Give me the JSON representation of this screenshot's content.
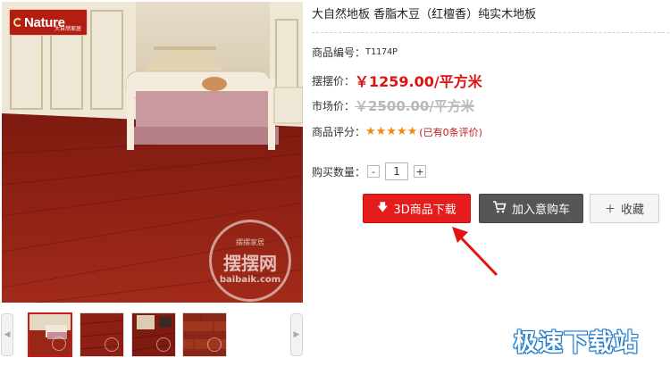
{
  "brand": {
    "logo_text": "Nature",
    "logo_sub": "大自然家居"
  },
  "main_image": {
    "watermark_top": "摆摆家居",
    "watermark_mid": "摆摆网",
    "watermark_bottom": "baibaik.com"
  },
  "product": {
    "title": "大自然地板 香脂木豆（红檀香）纯实木地板",
    "sku_label": "商品编号：",
    "sku_value": "T1174P",
    "price_label": "摆摆价：",
    "price_value": "￥1259.00/平方米",
    "market_label": "市场价：",
    "market_value": "￥2500.00/平方米",
    "rating_label": "商品评分：",
    "rating_stars": 5,
    "rating_text": "(已有0条评价)",
    "qty_label": "购买数量：",
    "qty_value": "1"
  },
  "actions": {
    "download_3d": "3D商品下载",
    "add_to_cart": "加入意购车",
    "favorite": "收藏"
  },
  "thumbnails": [
    {
      "name": "thumb-1",
      "active": true
    },
    {
      "name": "thumb-2",
      "active": false
    },
    {
      "name": "thumb-3",
      "active": false
    },
    {
      "name": "thumb-4",
      "active": false
    }
  ],
  "site_mark": "极速下载站",
  "colors": {
    "accent_red": "#e61b1b",
    "price_red": "#e0120f",
    "star_orange": "#f58a0f",
    "cart_gray": "#565656"
  },
  "icons": {
    "download": "download-arrow-icon",
    "cart": "cart-icon",
    "favorite": "plus-icon",
    "star": "star-icon"
  }
}
